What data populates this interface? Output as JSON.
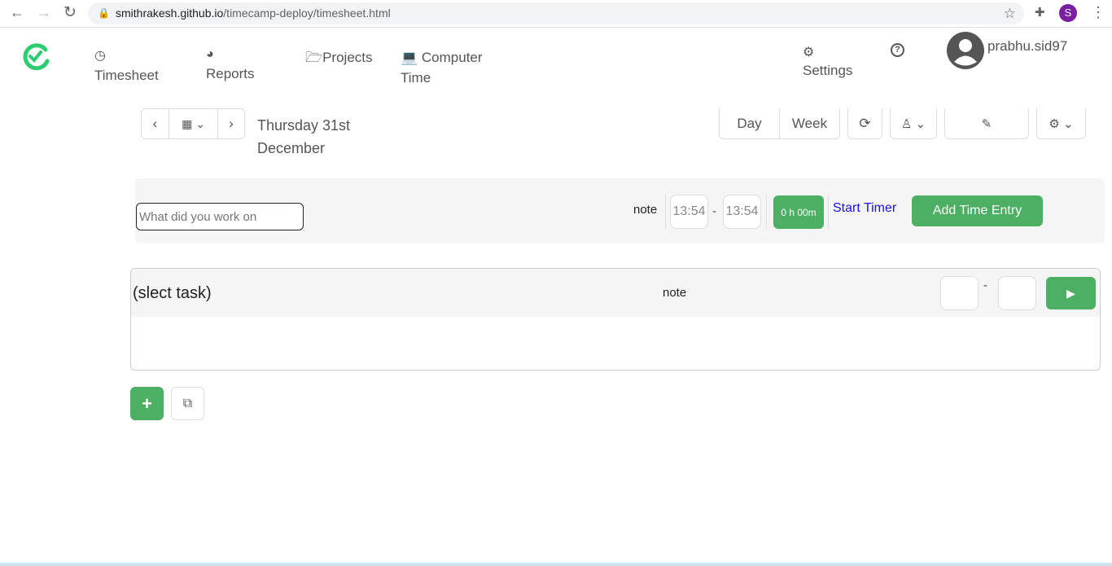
{
  "browser": {
    "url_domain": "smithrakesh.github.io",
    "url_path": "/timecamp-deploy/timesheet.html",
    "profile_initial": "S",
    "profile_color": "#7b1fa2"
  },
  "nav": {
    "timesheet": "Timesheet",
    "reports": "Reports",
    "projects": "Projects",
    "computer_time_1": "Computer",
    "computer_time_2": "Time",
    "settings": "Settings",
    "username": "prabhu.sid97"
  },
  "toolbar": {
    "date_1": "Thursday 31st",
    "date_2": "December",
    "day": "Day",
    "week": "Week"
  },
  "entry": {
    "placeholder": "What did you work on",
    "note": "note",
    "start": "13:54",
    "dash": "-",
    "end": "13:54",
    "duration": "0 h 00m",
    "start_timer": "Start Timer",
    "add": "Add Time Entry"
  },
  "task": {
    "title": "(slect task)",
    "note": "note",
    "dash": "-"
  },
  "colors": {
    "accent": "#4caf64",
    "brand": "#2ecc71",
    "link": "#1a0dff"
  }
}
